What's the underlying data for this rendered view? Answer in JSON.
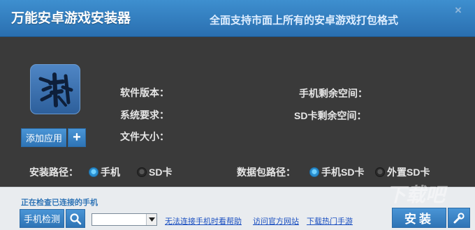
{
  "window": {
    "title": "万能安卓游戏安装器",
    "tagline": "全面支持市面上所有的安卓游戏打包格式",
    "close_glyph": "×"
  },
  "app_panel": {
    "icon": "app-game-icon",
    "add_app_label": "添加应用",
    "add_app_plus": "+"
  },
  "info": {
    "version_label": "软件版本：",
    "system_req_label": "系统要求：",
    "file_size_label": "文件大小：",
    "phone_space_label": "手机剩余空间：",
    "sd_space_label": "SD卡剩余空间："
  },
  "options": {
    "install_path_label": "安装路径：",
    "install_path_options": [
      {
        "label": "手机",
        "selected": true
      },
      {
        "label": "SD卡",
        "selected": false
      }
    ],
    "data_path_label": "数据包路径：",
    "data_path_options": [
      {
        "label": "手机SD卡",
        "selected": true
      },
      {
        "label": "外置SD卡",
        "selected": false
      }
    ]
  },
  "bottom": {
    "status": "正在检查已连接的手机",
    "detect_label": "手机检测",
    "device_select_value": "",
    "links": [
      "无法连接手机时看帮助",
      "访问官方网站",
      "下载热门手游"
    ],
    "install_label": "安装"
  },
  "watermark": "下载吧",
  "colors": {
    "title_bar": "#2f7cc0",
    "main_bg": "#3a3a3a",
    "accent_blue": "#2e74b5",
    "link_blue": "#1a4fc0",
    "bottom_bg": "#e9ecef"
  }
}
